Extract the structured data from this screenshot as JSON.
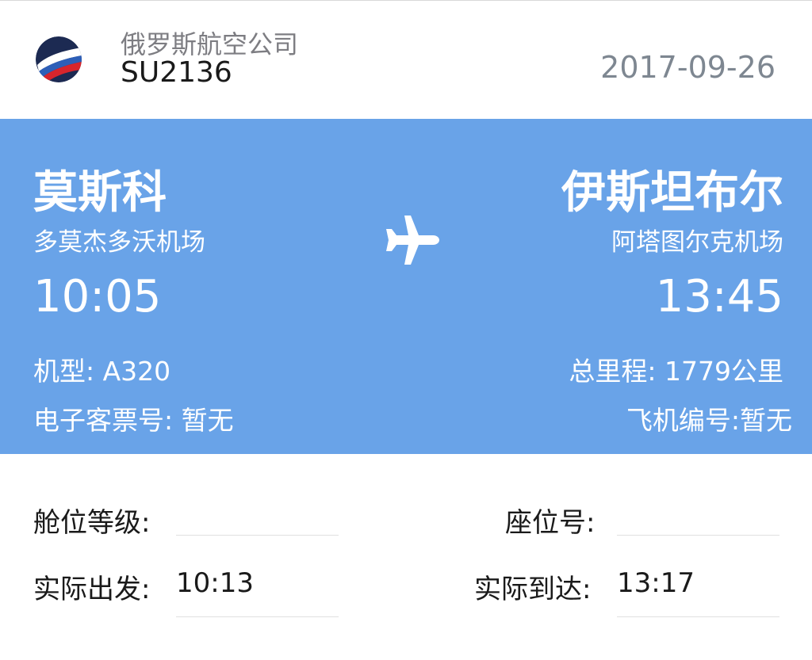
{
  "header": {
    "airline_name": "俄罗斯航空公司",
    "flight_number": "SU2136",
    "date": "2017-09-26",
    "logo_icon": "aeroflot-logo-icon"
  },
  "departure": {
    "city": "莫斯科",
    "airport": "多莫杰多沃机场",
    "time": "10:05",
    "aircraft": "机型: A320",
    "eticket": "电子客票号: 暂无"
  },
  "arrival": {
    "city": "伊斯坦布尔",
    "airport": "阿塔图尔克机场",
    "time": "13:45",
    "distance": "总里程: 1779公里",
    "plane_number": "飞机编号:暂无"
  },
  "route_icon": "airplane-icon",
  "details": {
    "cabin_class_label": "舱位等级:",
    "cabin_class_value": "",
    "seat_label": "座位号:",
    "seat_value": "",
    "actual_departure_label": "实际出发:",
    "actual_departure_value": "10:13",
    "actual_arrival_label": "实际到达:",
    "actual_arrival_value": "13:17"
  },
  "colors": {
    "panel": "#69a3e8",
    "date_text": "#7e8791",
    "airline_text": "#7d7d82"
  }
}
